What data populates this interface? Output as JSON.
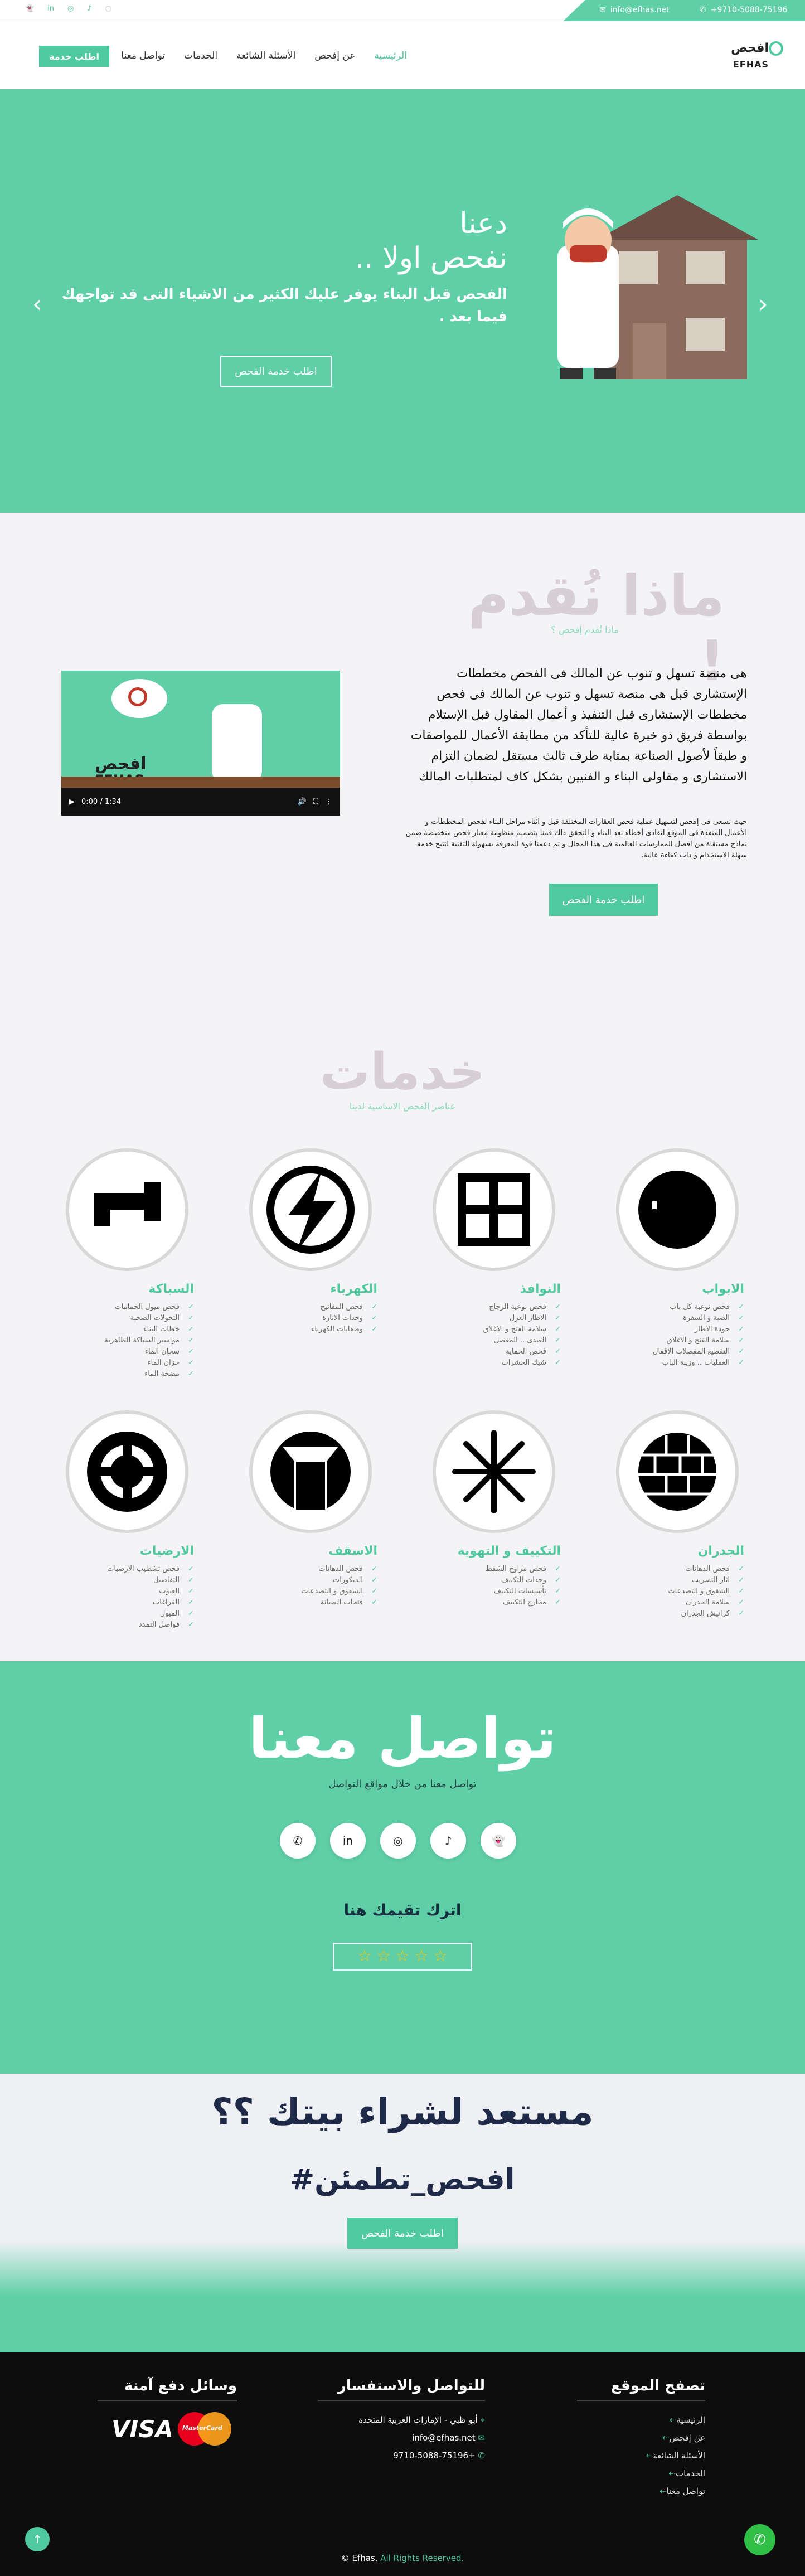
{
  "topbar": {
    "email": "info@efhas.net",
    "phone": "+9710-5088-75196",
    "social_icons": [
      "snapchat-icon",
      "tiktok-icon",
      "instagram-icon",
      "linkedin-icon",
      "whatsapp-icon"
    ]
  },
  "nav": {
    "logo_text_ar": "افحص",
    "logo_text_en": "EFHAS",
    "items": [
      {
        "label": "الرئيسية",
        "active": true
      },
      {
        "label": "عن إفحص",
        "active": false
      },
      {
        "label": "الأسئلة الشائعة",
        "active": false
      },
      {
        "label": "الخدمات",
        "active": false
      },
      {
        "label": "تواصل معنا",
        "active": false
      }
    ],
    "cta": "اطلب خدمة"
  },
  "hero": {
    "line1": "دعنا",
    "line2": "نفحص اولا ..",
    "body": "الفحص قبل البناء يوفر عليك الكثير من الاشياء التى قد تواجهك فيما بعد .",
    "cta": "اطلب خدمة الفحص"
  },
  "about": {
    "title": "ماذا نُقدم !",
    "subtitle": "ماذا تُقدم إفحص ؟",
    "lead": "هى منصة تسهل و تنوب عن المالك فى الفحص مخططات الإستشارى قبل هى منصة تسهل و تنوب عن المالك فى فحص مخططات الإستشارى قبل التنفيذ و أعمال المقاول قبل الإستلام بواسطة فريق ذو خبرة عالية للتأكد من مطابقة الأعمال للمواصفات و طبقاً لأصول الصناعة بمثابة طرف ثالث مستقل لضمان التزام الاستشارى و مقاولى البناء و الفنيين بشكل كاف لمتطلبات المالك",
    "detail": "حيث نسعى فى إفحص لتسهيل عملية فحص العقارات المختلفة قبل و اثناء مراحل البناء لفحص المخططات و الأعمال المنفذة فى الموقع لتفادى أخطاء بعد البناء و التحقق ذلك قمنا بتصميم منظومة معيار فحص متخصصة ضمن نماذج مستقاة من افضل الممارسات العالمية فى هذا المجال و تم دعمنا قوة المعرفة بسهولة التقنية لتتيح خدمة سهلة الاستخدام و ذات كفاءة عالية.",
    "cta": "اطلب خدمة الفحص",
    "video": {
      "time": "0:00 / 1:34",
      "logo_ar": "افحص",
      "logo_en": "EFHAS"
    }
  },
  "services": {
    "title": "خدمات",
    "subtitle": "عناصر الفحص الاساسية لدينا",
    "items": [
      {
        "name": "الابواب",
        "icon": "door-knob-icon",
        "points": [
          "فحص نوعية كل باب",
          "الصبة و الشفرة",
          "جودة الاطار",
          "سلامة الفتح و الاغلاق",
          "التقطيع المفصلات الاقفال",
          "العمليات .. وزينة الباب"
        ]
      },
      {
        "name": "النوافذ",
        "icon": "window-icon",
        "points": [
          "فحص نوعية الزجاج",
          "الاطار العزل",
          "سلامة الفتح و الاغلاق",
          "العيدى .. المفصل",
          "فحص الحماية",
          "شبك الحشرات"
        ]
      },
      {
        "name": "الكهرباء",
        "icon": "lightning-icon",
        "points": [
          "فحص المفاتيح",
          "وحدات الانارة",
          "وطفايات الكهرباء"
        ]
      },
      {
        "name": "السباكة",
        "icon": "pipe-icon",
        "points": [
          "فحص ميول الحمامات",
          "التحولات الصحية",
          "خطات البناء",
          "مواسير السباكة الظاهرية",
          "سخان الماء",
          "خزان الماء",
          "مضخة الماء"
        ]
      },
      {
        "name": "الجدران",
        "icon": "brick-wall-icon",
        "points": [
          "فحص الدهانات",
          "اثار التسريب",
          "الشقوق و التصدعات",
          "سلامة الجدران",
          "كرانيش الجدران"
        ]
      },
      {
        "name": "التكييف و التهوية",
        "icon": "snowflake-icon",
        "points": [
          "فحص مراوح الشفط",
          "وحدات التكييف",
          "تأسيسات التكييف",
          "مخارج التكييف"
        ]
      },
      {
        "name": "الاسقف",
        "icon": "ceiling-icon",
        "points": [
          "فحص الدهانات",
          "الديكورات",
          "الشقوق و التصدعات",
          "فتحات الصيانة"
        ]
      },
      {
        "name": "الارضيات",
        "icon": "floor-tile-icon",
        "points": [
          "فحص تشطيب الارضيات",
          "التفاصيل",
          "العيوب",
          "الفراغات",
          "الميول",
          "فواصل التمدد"
        ]
      }
    ]
  },
  "contact": {
    "title": "تواصل معنا",
    "subtitle": "تواصل معنا من خلال مواقع التواصل",
    "socials": [
      {
        "icon": "snapchat-icon",
        "glyph": "👻"
      },
      {
        "icon": "tiktok-icon",
        "glyph": "♪"
      },
      {
        "icon": "instagram-icon",
        "glyph": "◎"
      },
      {
        "icon": "linkedin-icon",
        "glyph": "in"
      },
      {
        "icon": "whatsapp-icon",
        "glyph": "✆"
      }
    ],
    "rating_title": "اترك تقيمك هنا",
    "stars": "☆ ☆ ☆ ☆ ☆"
  },
  "ready": {
    "title": "مستعد لشراء بيتك ؟؟",
    "hashtag": "#افحص_تطمئن",
    "cta": "اطلب خدمة الفحص"
  },
  "footer": {
    "col_browse_title": "تصفح الموقع",
    "browse_links": [
      "الرئيسية",
      "عن إفحص",
      "الأسئلة الشائعة",
      "الخدمات",
      "تواصل معنا"
    ],
    "col_contact_title": "للتواصل والاستفسار",
    "contact_lines": [
      "أبو ظبي - الإمارات العربية المتحدة",
      "info@efhas.net",
      "+9710-5088-75196"
    ],
    "col_pay_title": "وسائل دفع آمنة",
    "visa": "VISA",
    "mastercard": "MasterCard",
    "copyright_brand": "Efhas.",
    "copyright_rest": "All Rights Reserved.",
    "copyright_symbol": "©"
  },
  "colors": {
    "accent": "#4fc9a0",
    "hero_bg": "#5fcfa7",
    "footer_bg": "#0d0d0d",
    "title_gray": "#c9c1c5",
    "navy": "#1f2a48"
  }
}
